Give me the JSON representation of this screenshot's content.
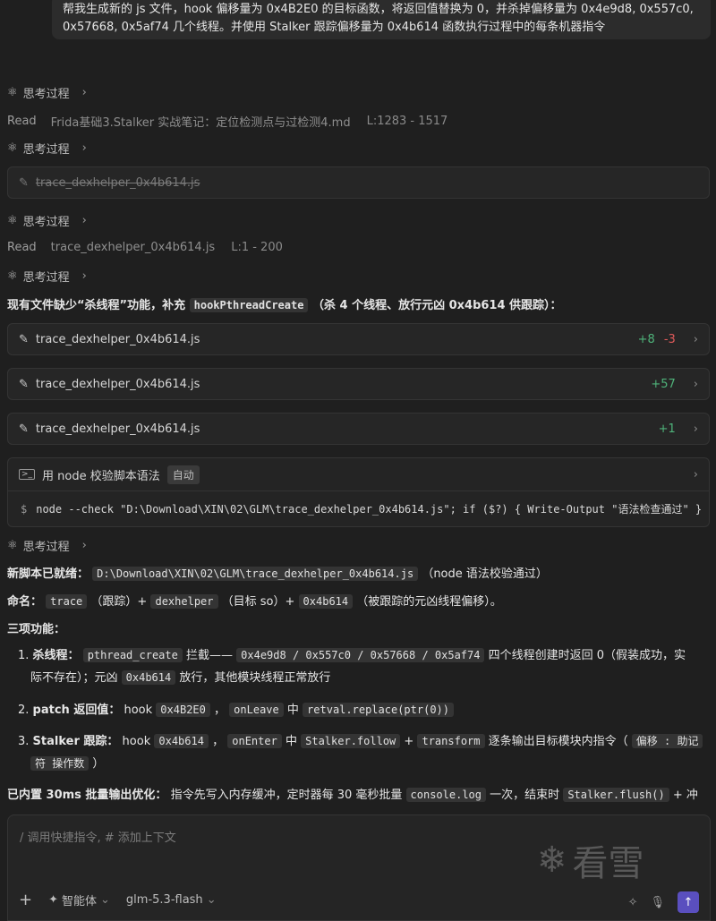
{
  "user_message": "帮我生成新的 js 文件，hook 偏移量为 0x4B2E0 的目标函数，将返回值替换为 0，并杀掉偏移量为 0x4e9d8, 0x557c0, 0x57668, 0x5af74 几个线程。并使用 Stalker 跟踪偏移量为 0x4b614 函数执行过程中的每条机器指令",
  "think_label": "思考过程",
  "read1": {
    "label": "Read",
    "file": "Frida基础3.Stalker 实战笔记：定位检测点与过检测4.md",
    "lines": "L:1283 - 1517"
  },
  "strike_file": "trace_dexhelper_0x4b614.js",
  "read2": {
    "label": "Read",
    "file": "trace_dexhelper_0x4b614.js",
    "lines": "L:1 - 200"
  },
  "intro": {
    "text1": "现有文件缺少“杀线程”功能，补充",
    "code": "hookPthreadCreate",
    "text2": "（杀 4 个线程、放行元凶 0x4b614 供跟踪）："
  },
  "edits": [
    {
      "file": "trace_dexhelper_0x4b614.js",
      "plus": "+8",
      "minus": "-3"
    },
    {
      "file": "trace_dexhelper_0x4b614.js",
      "plus": "+57",
      "minus": ""
    },
    {
      "file": "trace_dexhelper_0x4b614.js",
      "plus": "+1",
      "minus": ""
    }
  ],
  "terminal": {
    "title": "用 node 校验脚本语法",
    "badge": "自动",
    "prompt": "$",
    "command": "node --check \"D:\\Download\\XIN\\02\\GLM\\trace_dexhelper_0x4b614.js\"; if ($?) { Write-Output \"语法检查通过\" }"
  },
  "summary": {
    "ready_label": "新脚本已就绪：",
    "ready_path": "D:\\Download\\XIN\\02\\GLM\\trace_dexhelper_0x4b614.js",
    "ready_note": "（node 语法校验通过）",
    "name_label": "命名：",
    "name_c1": "trace",
    "name_t1": "（跟踪）+",
    "name_c2": "dexhelper",
    "name_t2": "（目标 so）+",
    "name_c3": "0x4b614",
    "name_t3": "（被跟踪的元凶线程偏移）。",
    "features_title": "三项功能：",
    "f1_title": "杀线程：",
    "f1_code1": "pthread_create",
    "f1_t1": "拦截——",
    "f1_code2": "0x4e9d8 / 0x557c0 / 0x57668 / 0x5af74",
    "f1_t2": "四个线程创建时返回 0（假装成功，实",
    "f1_t3": "际不存在）；元凶",
    "f1_code3": "0x4b614",
    "f1_t4": "放行，其他模块线程正常放行",
    "f2_title": "patch 返回值：",
    "f2_t1": "hook",
    "f2_code1": "0x4B2E0",
    "f2_t2": "，",
    "f2_code2": "onLeave",
    "f2_t3": "中",
    "f2_code3": "retval.replace(ptr(0))",
    "f3_title": "Stalker 跟踪：",
    "f3_t1": "hook",
    "f3_code1": "0x4b614",
    "f3_t2": "，",
    "f3_code2": "onEnter",
    "f3_t3": "中",
    "f3_code3": "Stalker.follow",
    "f3_t4": "+",
    "f3_code4": "transform",
    "f3_t5": "逐条输出目标模块内指令（",
    "f3_code5": "偏移 : 助记",
    "f3_code6": "符 操作数",
    "f3_t6": "）",
    "batch_title": "已内置 30ms 批量输出优化：",
    "batch_t1": "指令先写入内存缓冲，定时器每 30 毫秒批量",
    "batch_code1": "console.log",
    "batch_t2": "一次，结束时",
    "batch_code2": "Stalker.flush()",
    "batch_t3": "+ 冲"
  },
  "composer": {
    "placeholder": "/ 调用快捷指令, # 添加上下文",
    "agent_label": "智能体",
    "model_label": "glm-5.3-flash"
  },
  "watermark_text": "看雪"
}
